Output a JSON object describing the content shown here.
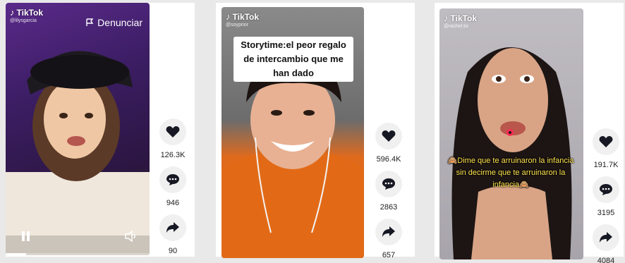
{
  "brand": "TikTok",
  "videos": [
    {
      "handle": "@lilysgarcia",
      "report_label": "Denunciar",
      "likes": "126.3K",
      "comments": "946",
      "shares": "90"
    },
    {
      "handle": "@soyprior",
      "caption": "Storytime:el peor regalo de intercambio que me han dado",
      "likes": "596.4K",
      "comments": "2863",
      "shares": "657"
    },
    {
      "handle": "@rachel.tix",
      "subtitle": "🙈Dime que te arruinaron la infancia sin decirme que te arruinaron la infancia🙈",
      "likes": "191.7K",
      "comments": "3195",
      "shares": "4084"
    }
  ],
  "colors": {
    "accent_red": "#fe2c55",
    "subtitle_yellow": "#ffe34d",
    "icon": "#161823"
  }
}
